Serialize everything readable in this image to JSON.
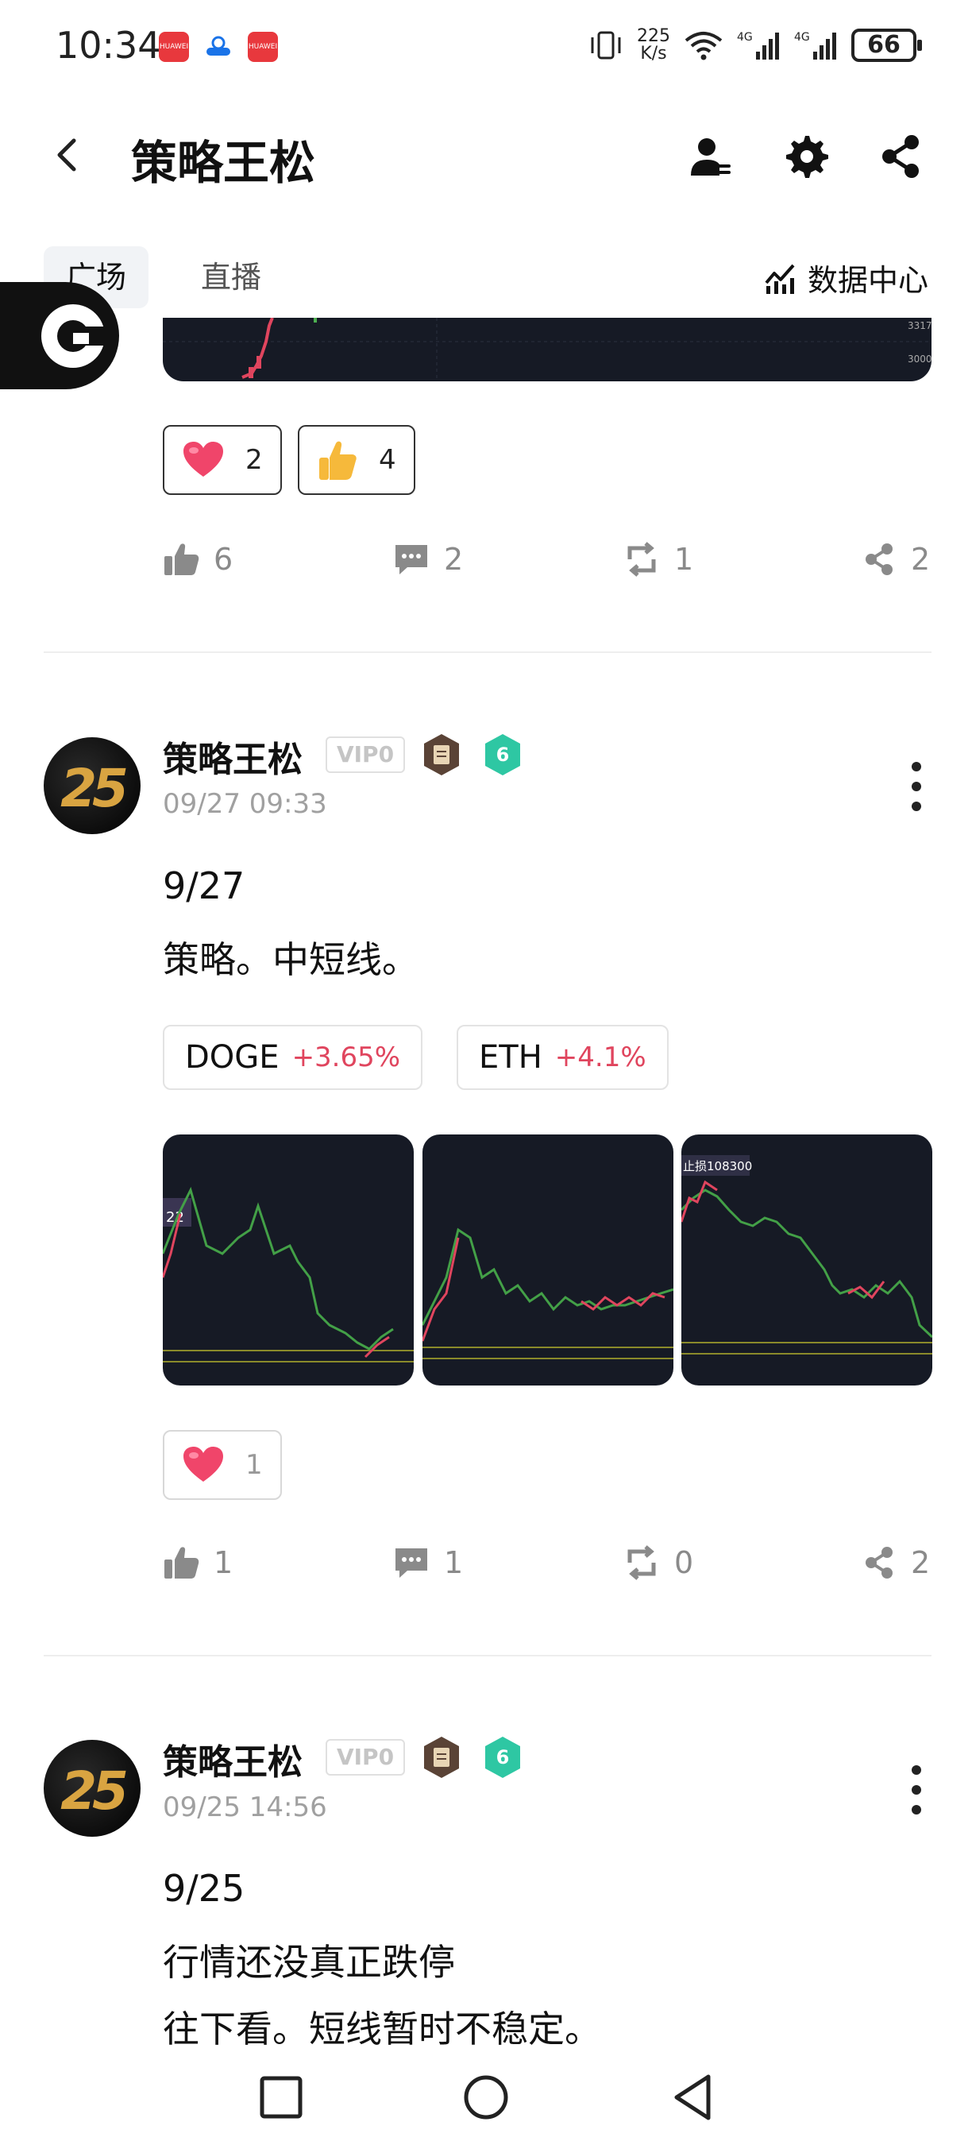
{
  "status_bar": {
    "time": "10:34",
    "net_speed_value": "225",
    "net_speed_unit": "K/s",
    "battery": "66",
    "badge_huawei_1": "HUAWEI",
    "badge_huawei_2": "HUAWEI"
  },
  "header": {
    "title": "策略王松"
  },
  "tabs": [
    {
      "label": "广场"
    },
    {
      "label": "直播"
    }
  ],
  "data_center_label": "数据中心",
  "post0": {
    "chart_ticks": [
      "3317",
      "3000"
    ],
    "reactions": [
      {
        "icon": "heart-icon",
        "count": "2"
      },
      {
        "icon": "thumbs-up-emoji-icon",
        "count": "4"
      }
    ],
    "actions": {
      "likes": "6",
      "comments": "2",
      "reposts": "1",
      "shares": "2"
    }
  },
  "post1": {
    "author": "策略王松",
    "vip": "VIP0",
    "level": "6",
    "time": "09/27 09:33",
    "lines": [
      "9/27",
      "策略。中短线。"
    ],
    "tickers": [
      {
        "symbol": "DOGE",
        "change": "+3.65%"
      },
      {
        "symbol": "ETH",
        "change": "+4.1%"
      }
    ],
    "thumb_labels": [
      "22",
      "止损108300"
    ],
    "reactions": [
      {
        "icon": "heart-icon",
        "count": "1"
      }
    ],
    "actions": {
      "likes": "1",
      "comments": "1",
      "reposts": "0",
      "shares": "2"
    }
  },
  "post2": {
    "author": "策略王松",
    "vip": "VIP0",
    "level": "6",
    "time": "09/25 14:56",
    "lines": [
      "9/25",
      "行情还没真正跌停",
      "往下看。短线暂时不稳定。"
    ]
  },
  "avatar_text": "25",
  "colors": {
    "accent_negative": "#e0455e",
    "chart_bg": "#161a25",
    "level_badge": "#2ec7a3"
  }
}
